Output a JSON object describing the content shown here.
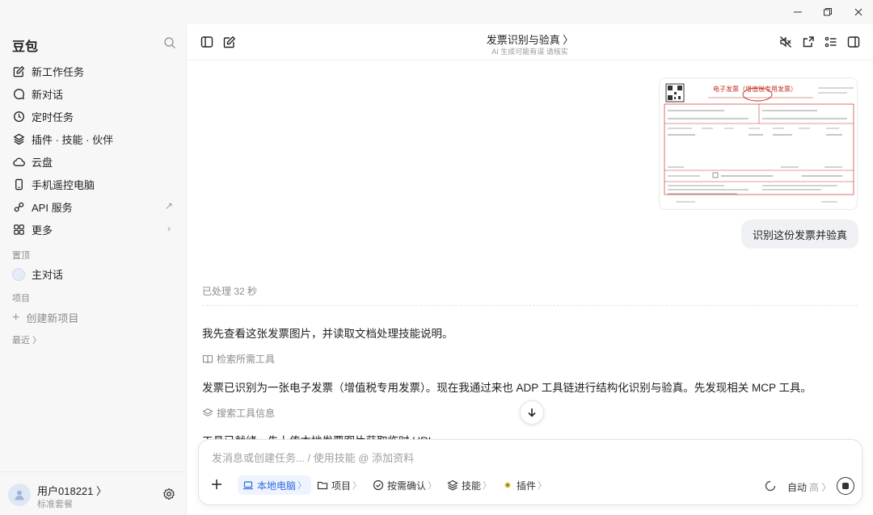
{
  "window": {
    "minimize_icon": "minimize-icon",
    "maximize_icon": "restore-icon",
    "close_icon": "close-icon"
  },
  "sidebar": {
    "brand": "豆包",
    "items": [
      {
        "label": "新工作任务",
        "icon": "edit-icon"
      },
      {
        "label": "新对话",
        "icon": "chat-bubble-icon"
      },
      {
        "label": "定时任务",
        "icon": "clock-icon"
      },
      {
        "label": "插件 · 技能 · 伙伴",
        "icon": "layers-icon"
      },
      {
        "label": "云盘",
        "icon": "cloud-icon"
      },
      {
        "label": "手机遥控电脑",
        "icon": "phone-icon"
      },
      {
        "label": "API 服务",
        "icon": "link-icon",
        "trail": "↗"
      },
      {
        "label": "更多",
        "icon": "grid-icon",
        "trail": "›"
      }
    ],
    "pinned_label": "置顶",
    "pinned_item": "主对话",
    "projects_label": "项目",
    "create_project": "创建新项目",
    "recent_label": "最近 〉",
    "user": {
      "name": "用户018221 〉",
      "plan": "标准套餐"
    }
  },
  "conversation": {
    "title": "发票识别与验真 〉",
    "subtitle": "AI 生成可能有误 请核实",
    "user_message": "识别这份发票并验真",
    "invoice_image": {
      "heading": "电子发票（增值税专用发票）"
    },
    "processed": "已处理 32 秒",
    "ai_lines": [
      "我先查看这张发票图片，并读取文档处理技能说明。",
      "发票已识别为一张电子发票（增值税专用发票）。现在我通过来也 ADP 工具链进行结构化识别与验真。先发现相关 MCP 工具。",
      "工具已就绪。先上传本地发票图片获取临时 URL。"
    ],
    "tool_steps": [
      "检索所需工具",
      "搜索工具信息"
    ]
  },
  "composer": {
    "placeholder": "发消息或创建任务... / 使用技能 @ 添加资料",
    "chips": [
      {
        "label": "本地电脑",
        "icon": "laptop-icon",
        "active": true
      },
      {
        "label": "项目",
        "icon": "folder-icon",
        "active": false
      },
      {
        "label": "按需确认",
        "icon": "check-circle-icon",
        "active": false
      },
      {
        "label": "技能",
        "icon": "layers-icon",
        "active": false
      },
      {
        "label": "插件",
        "icon": "plugin-icon",
        "active": false
      }
    ],
    "mode_label": "自动",
    "mode_level": "高 〉"
  },
  "colors": {
    "accent": "#2f6be0",
    "invoice_red": "#c0392b"
  }
}
